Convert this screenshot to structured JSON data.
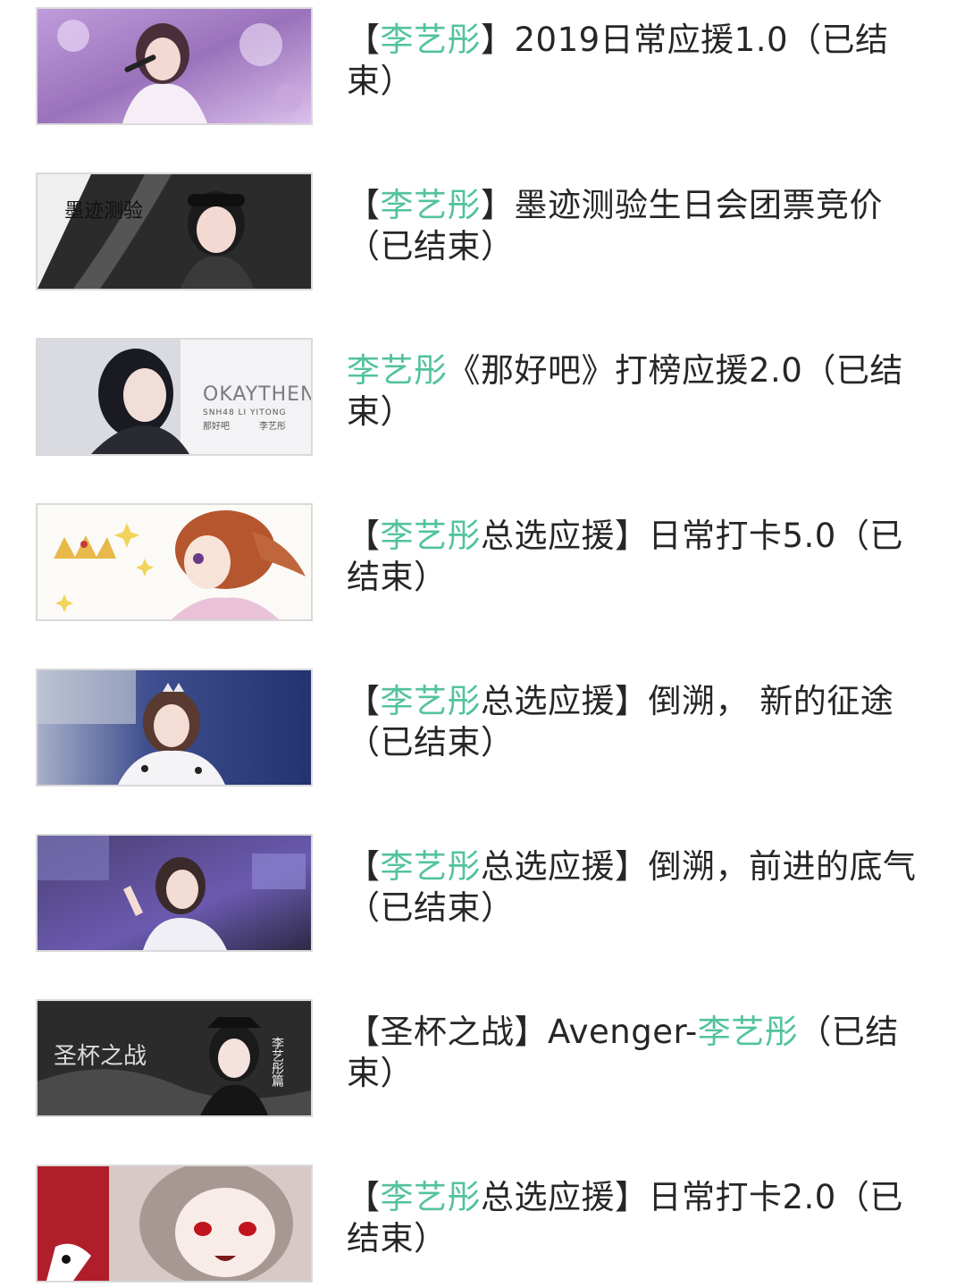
{
  "theme": {
    "text_color": "#262626",
    "highlight_color": "#52c39c",
    "thumb_border": "#d9d9d9"
  },
  "items": [
    {
      "title_parts": [
        {
          "text": "【",
          "hl": false
        },
        {
          "text": "李艺彤",
          "hl": true
        },
        {
          "text": "】2019日常应援1.0（已结束）",
          "hl": false
        }
      ],
      "thumb": {
        "icon": "concert-singer-photo"
      }
    },
    {
      "title_parts": [
        {
          "text": "【",
          "hl": false
        },
        {
          "text": "李艺彤",
          "hl": true
        },
        {
          "text": "】墨迹测验生日会团票竞价（已结束）",
          "hl": false
        }
      ],
      "thumb": {
        "icon": "ink-portrait-photo",
        "overlay_text": "墨迹测验"
      }
    },
    {
      "title_parts": [
        {
          "text": "李艺彤",
          "hl": true
        },
        {
          "text": "《那好吧》打榜应援2.0（已结束）",
          "hl": false
        }
      ],
      "thumb": {
        "icon": "single-cover-photo",
        "overlay_title": "OKAYTHEN",
        "overlay_sub": "SNH48 LI YITONG",
        "overlay_left": "那好吧",
        "overlay_right": "李艺彤"
      }
    },
    {
      "title_parts": [
        {
          "text": "【",
          "hl": false
        },
        {
          "text": "李艺彤",
          "hl": true
        },
        {
          "text": "总选应援】日常打卡5.0（已结束）",
          "hl": false
        }
      ],
      "thumb": {
        "icon": "anime-girl-illustration"
      }
    },
    {
      "title_parts": [
        {
          "text": "【",
          "hl": false
        },
        {
          "text": "李艺彤",
          "hl": true
        },
        {
          "text": "总选应援】倒溯， 新的征途（已结束）",
          "hl": false
        }
      ],
      "thumb": {
        "icon": "stage-photo-blue"
      }
    },
    {
      "title_parts": [
        {
          "text": "【",
          "hl": false
        },
        {
          "text": "李艺彤",
          "hl": true
        },
        {
          "text": "总选应援】倒溯，前进的底气（已结束）",
          "hl": false
        }
      ],
      "thumb": {
        "icon": "stage-photo-purple"
      }
    },
    {
      "title_parts": [
        {
          "text": "【圣杯之战】Avenger-",
          "hl": false
        },
        {
          "text": "李艺彤",
          "hl": true
        },
        {
          "text": "（已结束）",
          "hl": false
        }
      ],
      "thumb": {
        "icon": "holy-grail-poster",
        "overlay_text": "圣杯之战",
        "side_text": "李艺彤篇"
      }
    },
    {
      "title_parts": [
        {
          "text": "【",
          "hl": false
        },
        {
          "text": "李艺彤",
          "hl": true
        },
        {
          "text": "总选应援】日常打卡2.0（已结束）",
          "hl": false
        }
      ],
      "thumb": {
        "icon": "anime-girl-red-eyes"
      }
    }
  ]
}
